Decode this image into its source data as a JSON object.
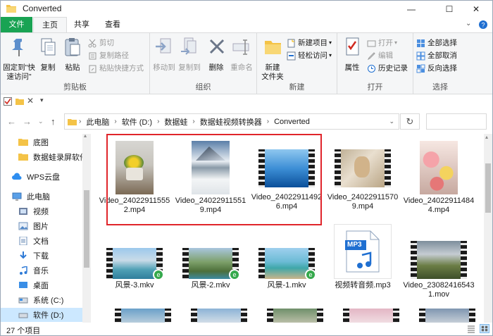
{
  "window": {
    "title": "Converted",
    "minimize": "—",
    "maximize": "☐",
    "close": "✕"
  },
  "tabs": {
    "file": "文件",
    "home": "主页",
    "share": "共享",
    "view": "查看"
  },
  "ribbon": {
    "pin": "固定到\"快速访问\"",
    "copy": "复制",
    "paste": "粘贴",
    "cut": "剪切",
    "copy_path": "复制路径",
    "paste_shortcut": "粘贴快捷方式",
    "clipboard_group": "剪贴板",
    "move_to": "移动到",
    "copy_to": "复制到",
    "delete": "删除",
    "rename": "重命名",
    "organize_group": "组织",
    "new_folder": "新建\n文件夹",
    "new_item": "新建项目",
    "easy_access": "轻松访问",
    "new_group": "新建",
    "properties": "属性",
    "open": "打开",
    "edit": "编辑",
    "history": "历史记录",
    "open_group": "打开",
    "select_all": "全部选择",
    "select_none": "全部取消",
    "invert_selection": "反向选择",
    "select_group": "选择"
  },
  "address": {
    "crumbs": [
      "此电脑",
      "软件 (D:)",
      "数据蛙",
      "数据蛙视频转换器",
      "Converted"
    ]
  },
  "nav_pane": {
    "items": [
      "底图",
      "数据蛙录屏软件",
      "WPS云盘",
      "此电脑",
      "视频",
      "图片",
      "文档",
      "下载",
      "音乐",
      "桌面",
      "系统 (C:)",
      "软件 (D:)"
    ]
  },
  "files": {
    "row1": [
      "Video_240229115552.mp4",
      "Video_240229115519.mp4",
      "Video_240229114926.mp4",
      "Video_240229115709.mp4",
      "Video_240229114844.mp4"
    ],
    "row2": [
      "风景-3.mkv",
      "风景-2.mkv",
      "风景-1.mkv",
      "视频转音频.mp3",
      "Video_230824165431.mov"
    ],
    "mp3_label": "MP3"
  },
  "status": {
    "count": "27 个项目"
  },
  "colors": {
    "file_tab": "#19a353",
    "highlight": "#e0252b",
    "selected": "#cce8ff"
  }
}
